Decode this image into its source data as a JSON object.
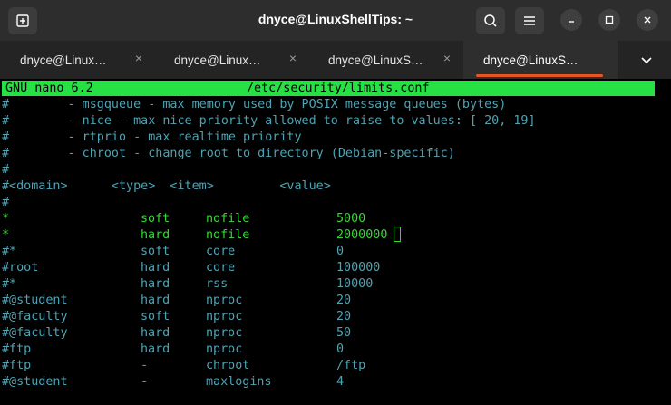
{
  "window": {
    "title": "dnyce@LinuxShellTips: ~"
  },
  "tabs": [
    {
      "label": "dnyce@Linux…",
      "active": false
    },
    {
      "label": "dnyce@Linux…",
      "active": false
    },
    {
      "label": "dnyce@LinuxS…",
      "active": false
    },
    {
      "label": "dnyce@LinuxS…",
      "active": true
    }
  ],
  "tab_close_glyph": "×",
  "colors": {
    "header_bg": "#26e044",
    "comment": "#4fa3b3",
    "code": "#35d835",
    "active_tab_accent": "#e95420"
  },
  "nano": {
    "version": "GNU nano 6.2",
    "filename": "/etc/security/limits.conf"
  },
  "comment_lines": [
    "#        - msgqueue - max memory used by POSIX message queues (bytes)",
    "#        - nice - max nice priority allowed to raise to values: [-20, 19]",
    "#        - rtprio - max realtime priority",
    "#        - chroot - change root to directory (Debian-specific)",
    "#",
    "#<domain>      <type>  <item>         <value>",
    "#"
  ],
  "entries": [
    {
      "domain": "*",
      "type": "soft",
      "item": "nofile",
      "value": "5000",
      "style": "code"
    },
    {
      "domain": "*",
      "type": "hard",
      "item": "nofile",
      "value": "2000000",
      "style": "code"
    },
    {
      "domain": "#*",
      "type": "soft",
      "item": "core",
      "value": "0",
      "style": "comment"
    },
    {
      "domain": "#root",
      "type": "hard",
      "item": "core",
      "value": "100000",
      "style": "comment"
    },
    {
      "domain": "#*",
      "type": "hard",
      "item": "rss",
      "value": "10000",
      "style": "comment"
    },
    {
      "domain": "#@student",
      "type": "hard",
      "item": "nproc",
      "value": "20",
      "style": "comment"
    },
    {
      "domain": "#@faculty",
      "type": "soft",
      "item": "nproc",
      "value": "20",
      "style": "comment"
    },
    {
      "domain": "#@faculty",
      "type": "hard",
      "item": "nproc",
      "value": "50",
      "style": "comment"
    },
    {
      "domain": "#ftp",
      "type": "hard",
      "item": "nproc",
      "value": "0",
      "style": "comment"
    },
    {
      "domain": "#ftp",
      "type": "-",
      "item": "chroot",
      "value": "/ftp",
      "style": "comment"
    },
    {
      "domain": "#@student",
      "type": "-",
      "item": "maxlogins",
      "value": "4",
      "style": "comment"
    }
  ]
}
